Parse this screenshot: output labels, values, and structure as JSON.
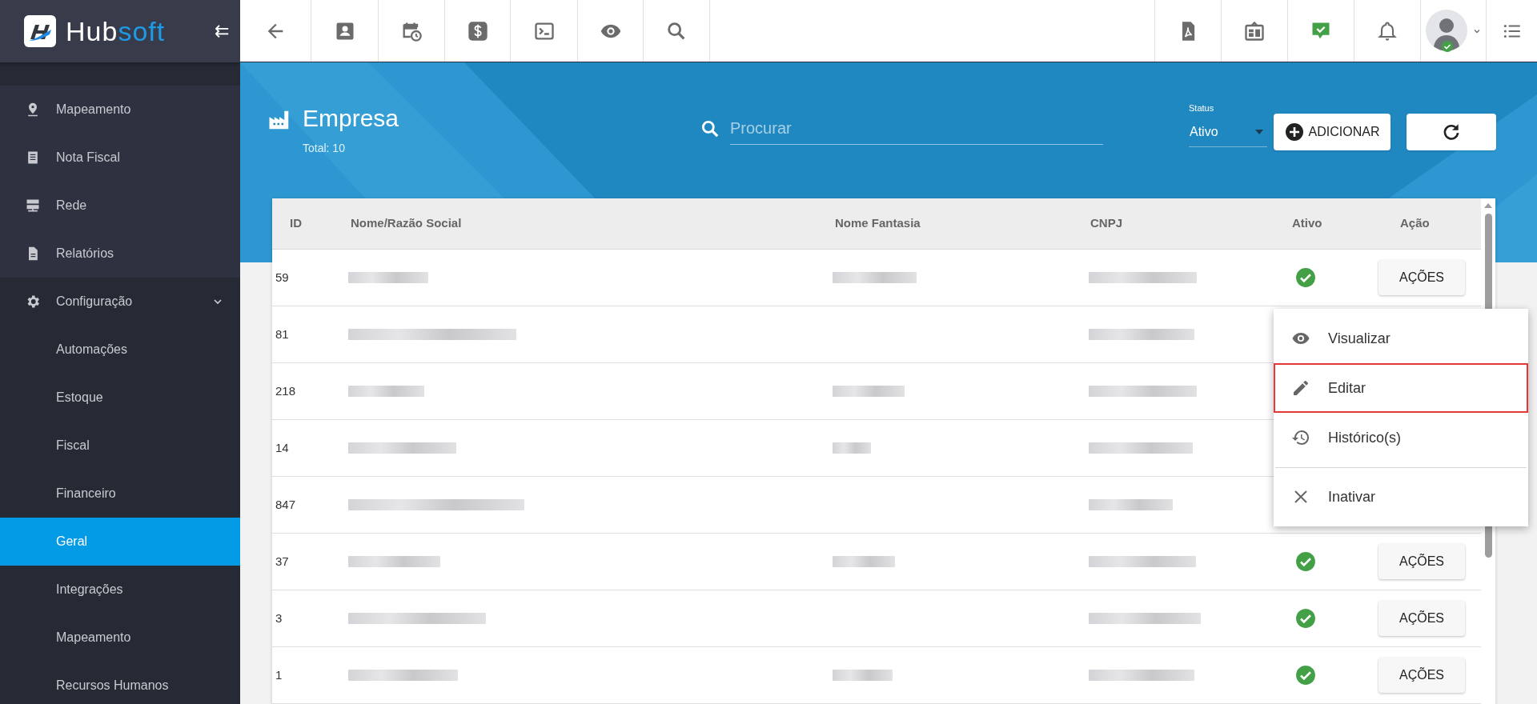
{
  "sidebar": {
    "logo": {
      "part_1": "Hub",
      "part_2": "soft"
    },
    "collapse_glyph": "⇇",
    "items": [
      {
        "label": "Mapeamento",
        "selected": false
      },
      {
        "label": "Nota Fiscal",
        "selected": false
      },
      {
        "label": "Rede",
        "selected": false
      },
      {
        "label": "Relatórios",
        "selected": false
      },
      {
        "label": "Configuração",
        "selected": false,
        "expanded": true,
        "children": [
          {
            "label": "Automações",
            "selected": false
          },
          {
            "label": "Estoque",
            "selected": false
          },
          {
            "label": "Fiscal",
            "selected": false
          },
          {
            "label": "Financeiro",
            "selected": false
          },
          {
            "label": "Geral",
            "selected": true
          },
          {
            "label": "Integrações",
            "selected": false
          },
          {
            "label": "Mapeamento",
            "selected": false
          },
          {
            "label": "Recursos Humanos",
            "selected": false
          }
        ]
      }
    ]
  },
  "header": {
    "title": "Empresa",
    "total": "Total: 10",
    "search": {
      "placeholder": "Procurar"
    },
    "status_filter": {
      "label": "Status",
      "value": "Ativo"
    },
    "add_button": "ADICIONAR"
  },
  "table": {
    "columns": [
      "ID",
      "Nome/Razão Social",
      "Nome Fantasia",
      "CNPJ",
      "Ativo",
      "Ação"
    ],
    "rows": [
      {
        "id": "59",
        "fantasia_shown": true,
        "active": true,
        "action": "AÇÕES"
      },
      {
        "id": "81",
        "fantasia_shown": false
      },
      {
        "id": "218",
        "fantasia_shown": true
      },
      {
        "id": "14",
        "fantasia_shown": true
      },
      {
        "id": "847",
        "fantasia_shown": false
      },
      {
        "id": "37",
        "fantasia_shown": true,
        "active": true,
        "action": "AÇÕES"
      },
      {
        "id": "3",
        "fantasia_shown": false,
        "active": true,
        "action": "AÇÕES"
      },
      {
        "id": "1",
        "fantasia_shown": true,
        "active": true,
        "action": "AÇÕES"
      }
    ]
  },
  "action_menu": {
    "items": [
      {
        "label": "Visualizar",
        "highlighted": false,
        "separated": false
      },
      {
        "label": "Editar",
        "highlighted": true,
        "separated": false
      },
      {
        "label": "Histórico(s)",
        "highlighted": false,
        "separated": false
      },
      {
        "label": "Inativar",
        "highlighted": false,
        "separated": true
      }
    ]
  }
}
